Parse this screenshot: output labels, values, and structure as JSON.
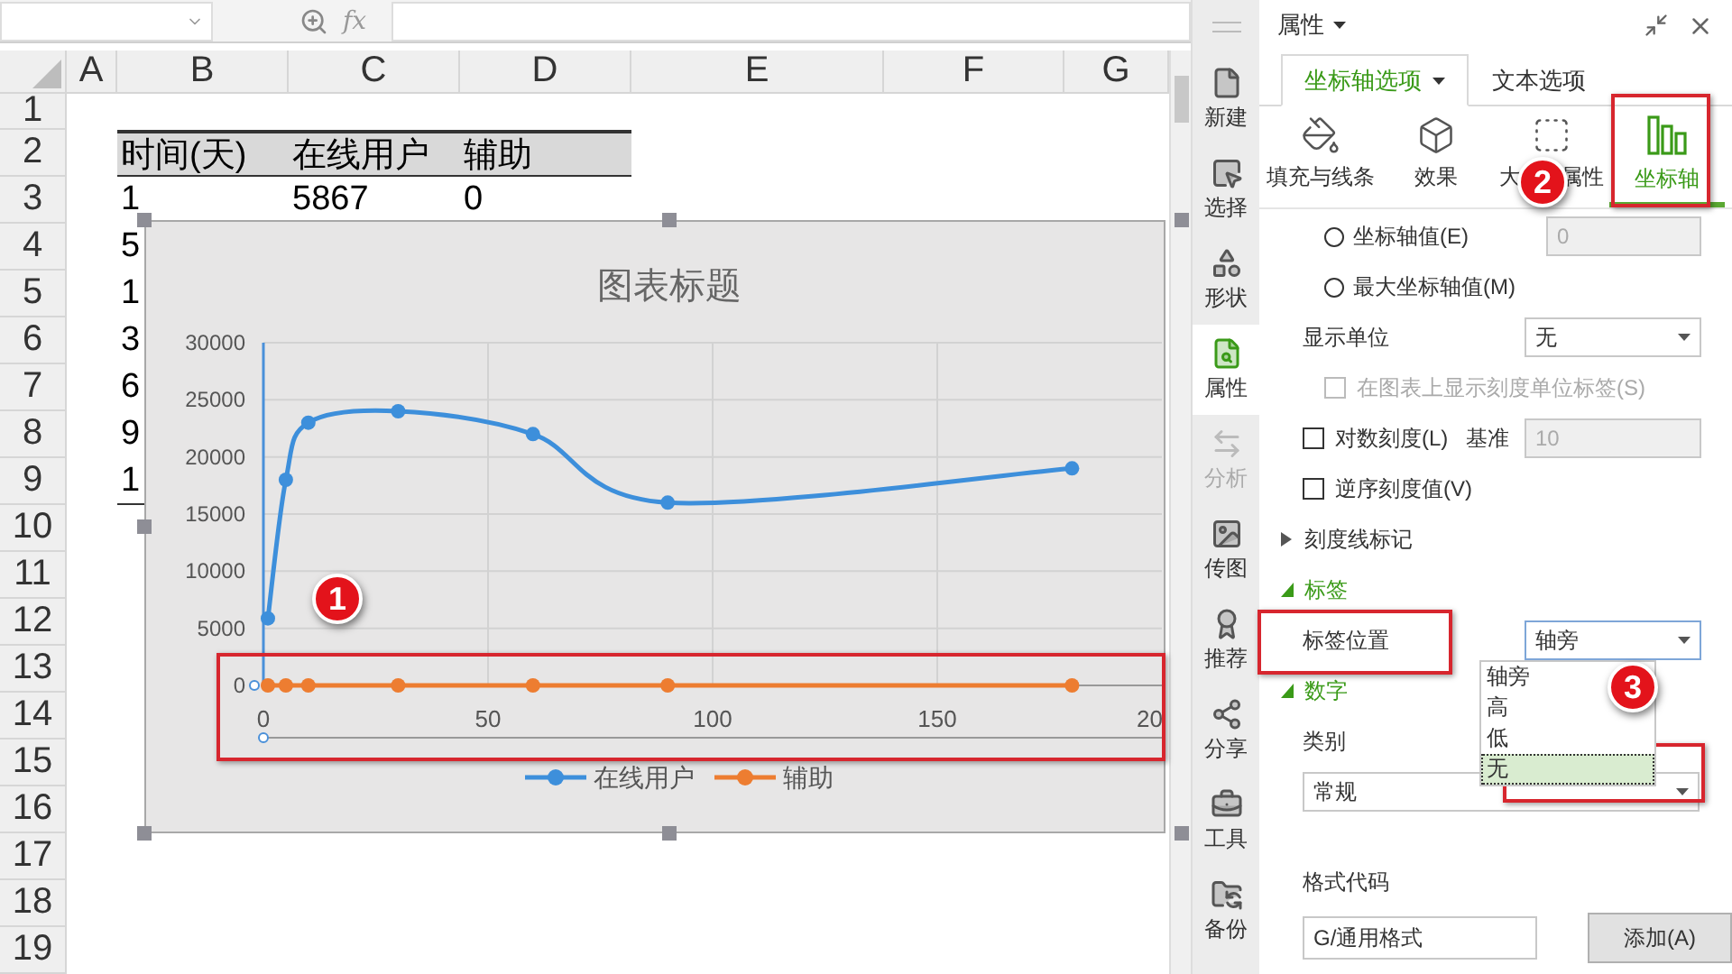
{
  "formula_bar": {
    "fx_label": "fx"
  },
  "sheet": {
    "columns": [
      "A",
      "B",
      "C",
      "D",
      "E",
      "F",
      "G"
    ],
    "row_numbers": [
      "1",
      "2",
      "3",
      "4",
      "5",
      "6",
      "7",
      "8",
      "9",
      "10",
      "11",
      "12",
      "13",
      "14",
      "15",
      "16",
      "17",
      "18",
      "19"
    ],
    "table": {
      "header": [
        "时间(天)",
        "在线用户",
        "辅助"
      ],
      "rows": [
        [
          "1",
          "5867",
          "0"
        ],
        [
          "5"
        ],
        [
          "1"
        ],
        [
          "3"
        ],
        [
          "6"
        ],
        [
          "9"
        ],
        [
          "1"
        ]
      ]
    }
  },
  "chart": {
    "cut_tick_label": "20",
    "chart_data": {
      "type": "line",
      "title": "图表标题",
      "x": [
        1,
        5,
        10,
        30,
        60,
        90,
        180
      ],
      "grid": true,
      "legend": "bottom",
      "series": [
        {
          "name": "在线用户",
          "color": "#3d8fdb",
          "marker": "circle",
          "values": [
            5867,
            18000,
            23000,
            24000,
            22000,
            16000,
            19000
          ]
        },
        {
          "name": "辅助",
          "color": "#ed7d31",
          "marker": "circle",
          "values": [
            0,
            0,
            0,
            0,
            0,
            0,
            0
          ]
        }
      ],
      "xlim": [
        0,
        200
      ],
      "ylim": [
        0,
        30000
      ],
      "xticks": [
        0,
        50,
        100,
        150
      ],
      "yticks": [
        0,
        5000,
        10000,
        15000,
        20000,
        25000,
        30000
      ]
    }
  },
  "callouts": [
    {
      "label": "1"
    },
    {
      "label": "2"
    },
    {
      "label": "3"
    }
  ],
  "toolstrip": {
    "items": [
      {
        "label": "新建",
        "selected": false,
        "disabled": false
      },
      {
        "label": "选择",
        "selected": false,
        "disabled": false
      },
      {
        "label": "形状",
        "selected": false,
        "disabled": false
      },
      {
        "label": "属性",
        "selected": true,
        "disabled": false
      },
      {
        "label": "分析",
        "selected": false,
        "disabled": true
      },
      {
        "label": "传图",
        "selected": false,
        "disabled": false
      },
      {
        "label": "推荐",
        "selected": false,
        "disabled": false
      },
      {
        "label": "分享",
        "selected": false,
        "disabled": false
      },
      {
        "label": "工具",
        "selected": false,
        "disabled": false
      },
      {
        "label": "备份",
        "selected": false,
        "disabled": false
      }
    ]
  },
  "panel": {
    "title": "属性",
    "tabs": [
      {
        "label": "坐标轴选项",
        "selected": true
      },
      {
        "label": "文本选项",
        "selected": false
      }
    ],
    "icon_tabs": [
      {
        "label_parts": [
          "填充与线条"
        ],
        "selected": false
      },
      {
        "label_parts": [
          "效果"
        ],
        "selected": false
      },
      {
        "label_parts": [
          "大",
          "属性"
        ],
        "selected": false
      },
      {
        "label_parts": [
          "坐标轴"
        ],
        "selected": true
      }
    ],
    "options": [
      {
        "kind": "radio",
        "label": "坐标轴值(E)",
        "checked": false,
        "disabled": false,
        "value": "0",
        "field_disabled": true
      },
      {
        "kind": "radio",
        "label": "最大坐标轴值(M)",
        "checked": false,
        "disabled": false
      },
      {
        "kind": "select",
        "label": "显示单位",
        "value": "无",
        "expanded": false
      },
      {
        "kind": "checkbox",
        "label": "在图表上显示刻度单位标签(S)",
        "checked": false,
        "disabled": true
      },
      {
        "kind": "checkbox",
        "label": "对数刻度(L)",
        "checked": false,
        "disabled": false,
        "field_label": "基准",
        "value": "10",
        "field_disabled": true
      },
      {
        "kind": "checkbox",
        "label": "逆序刻度值(V)",
        "checked": false,
        "disabled": false
      },
      {
        "kind": "section",
        "label": "刻度线标记",
        "expanded": false
      },
      {
        "kind": "section",
        "label": "标签",
        "expanded": true
      },
      {
        "kind": "select",
        "label": "标签位置",
        "value": "轴旁",
        "expanded": true,
        "options": [
          {
            "label": "轴旁",
            "highlighted": false
          },
          {
            "label": "高",
            "highlighted": false
          },
          {
            "label": "低",
            "highlighted": false
          },
          {
            "label": "无",
            "highlighted": true
          }
        ]
      },
      {
        "kind": "section",
        "label": "数字",
        "expanded": true
      },
      {
        "kind": "label",
        "label": "类别"
      },
      {
        "kind": "wide_select",
        "value": "常规"
      },
      {
        "kind": "label",
        "label": "格式代码"
      },
      {
        "kind": "input_button",
        "value": "G/通用格式",
        "button": "添加(A)"
      }
    ]
  }
}
